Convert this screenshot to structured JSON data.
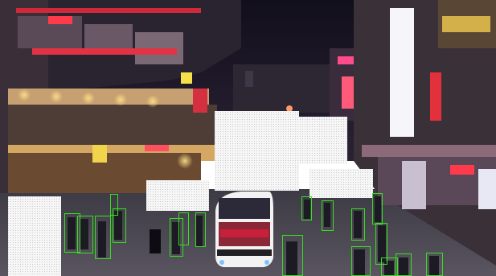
{
  "scene": {
    "kind": "night pedestrian street with lit storefronts and a shuttle bus",
    "colors": {
      "sky": "#1a1526",
      "street": "#4a4650",
      "storefront_glow": "#f3c66a",
      "neon_red": "#e0303a",
      "neon_pink": "#f05a8c",
      "bus_body": "#f2f2f2",
      "bus_stripe": "#c8203a",
      "mask_fill": "#f4f4f4",
      "bbox_stroke": "#35e01e"
    }
  },
  "annotations": {
    "pedestrian_boxes_count": 17,
    "mask_regions_count": 5
  }
}
